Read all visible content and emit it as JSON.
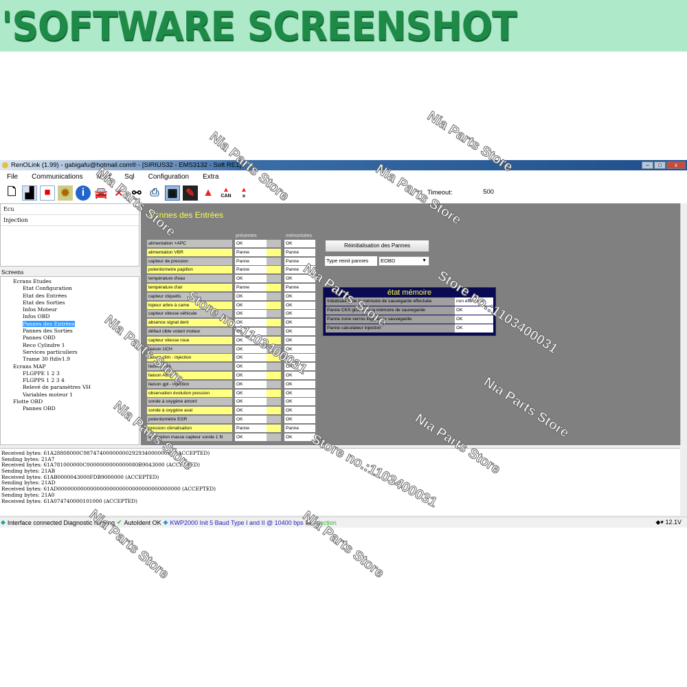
{
  "banner": {
    "title": "'SOFTWARE SCREENSHOT"
  },
  "window": {
    "title": "RenOLink (1.99) - gabigafu@hotmail.com® -  [SIRIUS32 - EMS3132 - Soft RE1]",
    "minimize": "–",
    "maximize": "□",
    "close": "x"
  },
  "menu": [
    "File",
    "Communications",
    "Misc",
    "Sql",
    "Configuration",
    "Extra"
  ],
  "toolbar": {
    "icons": [
      "new-file",
      "step",
      "stop",
      "gear",
      "info",
      "car-scan",
      "delete",
      "binoculars",
      "printer",
      "settings-panel",
      "connector",
      "warning",
      "warning-can",
      "warning-x"
    ],
    "can_label": "CAN",
    "timeout_label": "Timeout:",
    "timeout_value": "500"
  },
  "ecu": {
    "header": "Ecu",
    "items": [
      "Injection"
    ]
  },
  "screens": {
    "label": "Screens",
    "tree": [
      {
        "level": 0,
        "label": "Ecrans Etudes"
      },
      {
        "level": 1,
        "label": "Etat Configuration"
      },
      {
        "level": 1,
        "label": "Etat des Entrées"
      },
      {
        "level": 1,
        "label": "Etat des Sorties"
      },
      {
        "level": 1,
        "label": "Infos Moteur"
      },
      {
        "level": 1,
        "label": "Infos OBD"
      },
      {
        "level": 1,
        "label": "Pannes des Entrées",
        "selected": true
      },
      {
        "level": 1,
        "label": "Pannes des Sorties"
      },
      {
        "level": 1,
        "label": "Pannes OBD"
      },
      {
        "level": 1,
        "label": "Reco Cylindre 1"
      },
      {
        "level": 1,
        "label": "Services particuliers"
      },
      {
        "level": 1,
        "label": "Trame 30 ftdiv1.9"
      },
      {
        "level": 0,
        "label": "Ecrans MAP"
      },
      {
        "level": 1,
        "label": "FLGPPE 1 2 3"
      },
      {
        "level": 1,
        "label": "FLGPPS 1 2 3 4"
      },
      {
        "level": 1,
        "label": "Relevé de paramètres VH"
      },
      {
        "level": 1,
        "label": "Variables moteur 1"
      },
      {
        "level": 0,
        "label": "Flotte OBD"
      },
      {
        "level": 1,
        "label": "Pannes OBD"
      }
    ]
  },
  "panel": {
    "title": "Pannes des Entrées",
    "col_present": "présentes",
    "col_memorized": "mémorisées",
    "rows": [
      [
        "alimentation +APC",
        "OK",
        "OK"
      ],
      [
        "alimentation VBR",
        "Panne",
        "Panne"
      ],
      [
        "capteur de pression",
        "Panne",
        "Panne"
      ],
      [
        "potentiometre papillon",
        "Panne",
        "Panne"
      ],
      [
        "température d'eau",
        "OK",
        "OK"
      ],
      [
        "température d'air",
        "Panne",
        "Panne"
      ],
      [
        "capteur cliquetis",
        "OK",
        "OK"
      ],
      [
        "topeur arbre à came",
        "OK",
        "OK"
      ],
      [
        "capteur vitesse véhicule",
        "OK",
        "OK"
      ],
      [
        "absence signal dent",
        "OK",
        "OK"
      ],
      [
        "défaut cible volant moteur",
        "OK",
        "OK"
      ],
      [
        "capteur vitesse roue",
        "OK",
        "OK"
      ],
      [
        "liaison UCH",
        "OK",
        "OK"
      ],
      [
        "liaison clim - injection",
        "OK",
        "OK"
      ],
      [
        "liaison BVA",
        "OK",
        "OK"
      ],
      [
        "liaison ABS",
        "OK",
        "OK"
      ],
      [
        "liaison gpl - injection",
        "OK",
        "OK"
      ],
      [
        "observation évolution pression",
        "OK",
        "OK"
      ],
      [
        "sonde à oxygène amont",
        "OK",
        "OK"
      ],
      [
        "sonde à oxygène aval",
        "OK",
        "OK"
      ],
      [
        "potentiomètre EGR",
        "OK",
        "OK"
      ],
      [
        "pression climatisation",
        "Panne",
        "Panne"
      ],
      [
        "acquisition masse capteur sonde 1 fil",
        "OK",
        "OK"
      ]
    ],
    "reset_button": "Réinitialisation des Pannes",
    "reset_type_label": "Type reinit pannes",
    "reset_type_value": "EOBD",
    "memory": {
      "title": "état mémoire",
      "rows": [
        [
          "Initialisation de la mémoire de sauvegarde effectuée",
          "non effectuée"
        ],
        [
          "Panne CKS global de la mémoire de sauvegarde",
          "OK"
        ],
        [
          "Panne zone verrou logiciel de sauvegarde",
          "OK"
        ],
        [
          "Panne calculateur injection",
          "OK"
        ]
      ]
    }
  },
  "log": [
    "Received bytes: 61A28808000C98747400000000292934000000FF (ACCEPTED)",
    "Sending bytes: 21A7",
    "Received bytes: 61A781000000C0000000000000080B9043000 (ACCEPTED)",
    "Sending bytes: 21AB",
    "Received bytes: 61AB0000043000FDB9000000 (ACCEPTED)",
    "Sending bytes: 21AD",
    "Received bytes: 61AD00000000000000000000000000000000000000 (ACCEPTED)",
    "Sending bytes: 21A0",
    "Received bytes: 61A074740000101000 (ACCEPTED)"
  ],
  "status": {
    "interface": "Interface connected Diagnostic running",
    "autoident": "AutoIdent OK",
    "protocol": "KWP2000 Init 5 Baud Type I and II @ 10400 bps",
    "ecu": "Injection",
    "voltage": "12.1V"
  },
  "colors": {
    "panel_bg": "#808080",
    "row_yellow": "#ffff80",
    "row_gray": "#c0c0c0",
    "memory_bg": "#0a0a52",
    "title_yellow": "#ffff40"
  },
  "watermarks": [
    "Nia Parts Store",
    "Store no.:1103400031"
  ]
}
